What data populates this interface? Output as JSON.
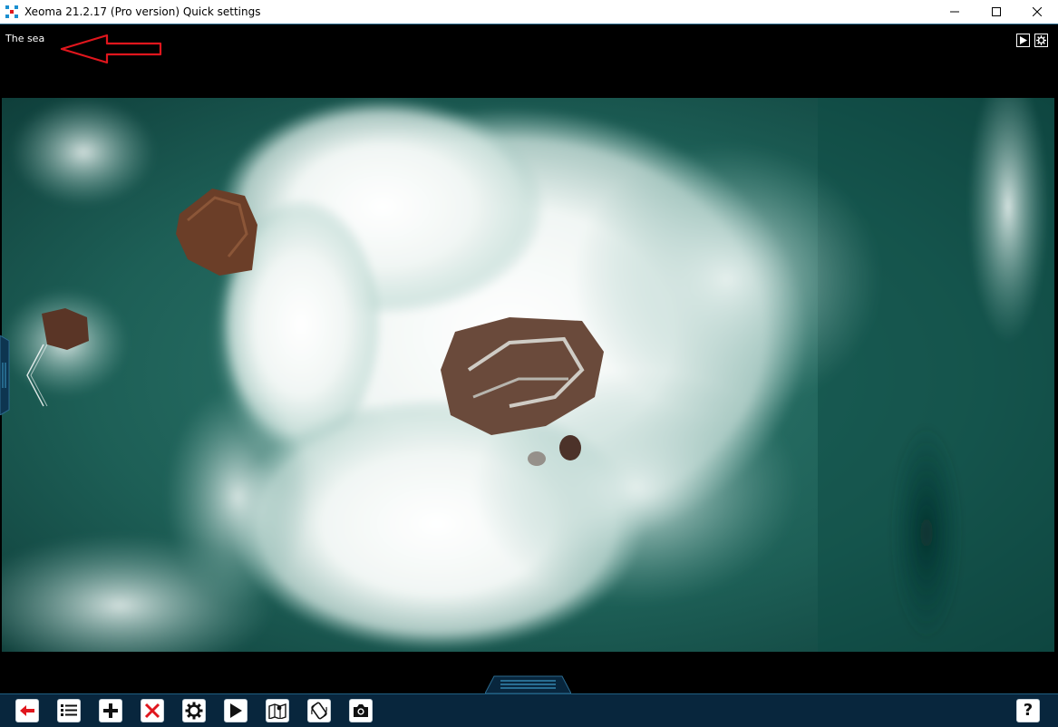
{
  "window": {
    "title": "Xeoma 21.2.17 (Pro version) Quick settings",
    "controls": [
      "minimize-icon",
      "maximize-icon",
      "close-icon"
    ]
  },
  "camera": {
    "name": "The sea",
    "annotation": "red-arrow-icon",
    "controls": [
      "play-icon",
      "gear-icon"
    ]
  },
  "toolbar": {
    "buttons": [
      {
        "name": "back-button",
        "icon": "back-arrow-icon"
      },
      {
        "name": "camera-list-button",
        "icon": "list-icon"
      },
      {
        "name": "add-camera-button",
        "icon": "plus-icon"
      },
      {
        "name": "delete-camera-button",
        "icon": "cross-icon"
      },
      {
        "name": "settings-button",
        "icon": "gear-icon"
      },
      {
        "name": "archive-play-button",
        "icon": "play-icon"
      },
      {
        "name": "map-button",
        "icon": "map-icon"
      },
      {
        "name": "ptz-button",
        "icon": "ptz-icon"
      },
      {
        "name": "snapshot-button",
        "icon": "camera-icon"
      }
    ],
    "help": {
      "name": "help-button",
      "icon": "question-icon",
      "label": "?"
    }
  },
  "colors": {
    "toolbar_bg": "#08263d",
    "accent": "#2b6b90",
    "annotation": "#e0161d",
    "danger": "#e0161d"
  }
}
